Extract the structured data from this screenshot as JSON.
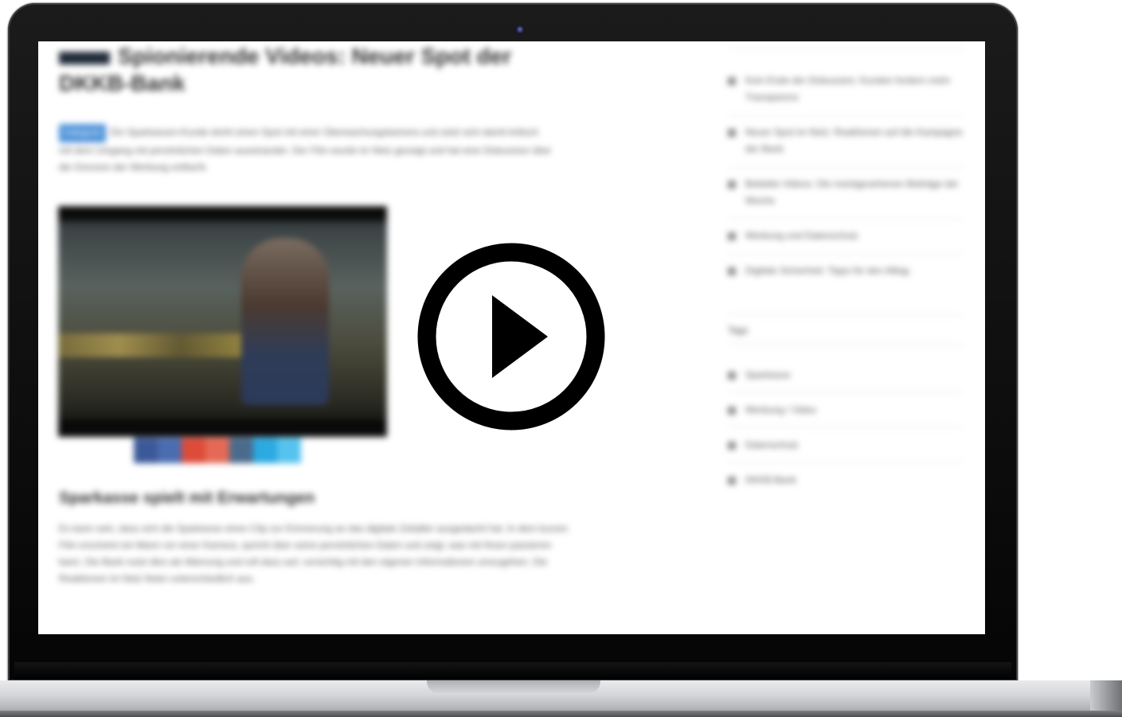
{
  "article": {
    "title": "Spionierende Videos: Neuer Spot der DKKB-Bank",
    "tag": "Kategorie",
    "lead": "Ein Sparkassen-Kunde dreht einen Spot mit einer Überwachungskamera und setzt sich damit kritisch mit dem Umgang mit persönlichen Daten auseinander. Der Film wurde im Netz gezeigt und hat eine Diskussion über die Grenzen der Werbung entfacht.",
    "subhead": "Sparkasse spielt mit Erwartungen",
    "body": "Es kann sein, dass sich die Sparkasse einen Clip zur Erinnerung an das digitale Zeitalter ausgedacht hat. In dem kurzen Film erscheint ein Mann vor einer Kamera, spricht über seine persönlichen Daten und zeigt, was mit ihnen passieren kann. Die Bank nutzt dies als Warnung und ruft dazu auf, vorsichtig mit den eigenen Informationen umzugehen. Die Reaktionen im Netz fielen unterschiedlich aus."
  },
  "sidebar": {
    "top_items": [
      "Kein Ende der Diskussion: Kunden fordern mehr Transparenz",
      "Neuer Spot im Netz: Reaktionen auf die Kampagne der Bank",
      "Beliebte Videos: Die meistgesehenen Beiträge der Woche",
      "Werbung und Datenschutz",
      "Digitale Sicherheit: Tipps für den Alltag"
    ],
    "section_title": "Tags",
    "tag_items": [
      "Sparkasse",
      "Werbung / Video",
      "Datenschutz",
      "DKKB-Bank"
    ]
  },
  "player": {
    "icon": "play-icon"
  },
  "colors": {
    "play": "#000000",
    "accent": "#4a90d9"
  }
}
